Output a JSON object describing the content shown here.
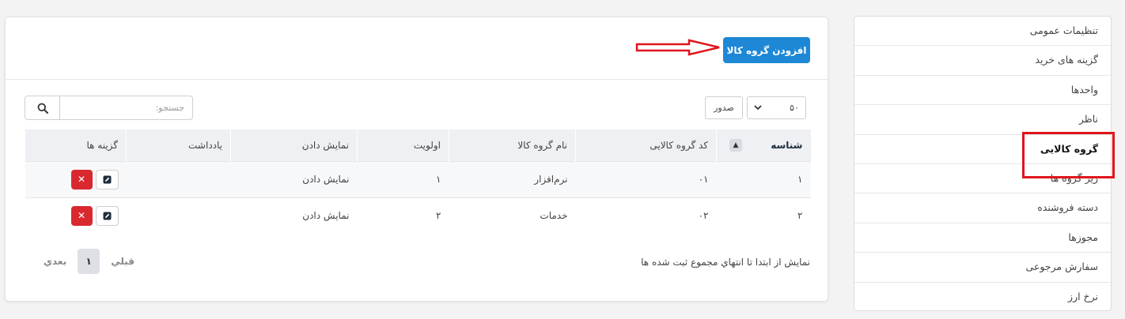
{
  "sidebar": {
    "items": [
      {
        "label": "تنظیمات عمومی"
      },
      {
        "label": "گزینه های خرید"
      },
      {
        "label": "واحدها"
      },
      {
        "label": "ناظر"
      },
      {
        "label": "گروه کالایی"
      },
      {
        "label": "زیر گروه ها"
      },
      {
        "label": "دسته فروشنده"
      },
      {
        "label": "مجوزها"
      },
      {
        "label": "سفارش مرجوعی"
      },
      {
        "label": "نرخ ارز"
      }
    ],
    "active_index": 4
  },
  "header": {
    "add_button_label": "افزودن گروه کالا"
  },
  "search": {
    "placeholder": "جستجو:",
    "value": ""
  },
  "page_size": {
    "value": "۵۰",
    "rows_label": "صدور"
  },
  "table": {
    "columns": [
      "شناسه",
      "کد گروه کالایی",
      "نام گروه کالا",
      "اولویت",
      "نمایش دادن",
      "یادداشت",
      "گزینه ها"
    ],
    "rows": [
      {
        "id": "۱",
        "code": "۰۱",
        "name": "نرم‌افزار",
        "priority": "۱",
        "display": "نمایش دادن",
        "note": ""
      },
      {
        "id": "۲",
        "code": "۰۲",
        "name": "خدمات",
        "priority": "۲",
        "display": "نمایش دادن",
        "note": ""
      }
    ]
  },
  "footer": {
    "info": "نمایش از ابتدا تا انتهاي مجموع ثبت شده ها",
    "prev_label": "قبلي",
    "current_page": "۱",
    "next_label": "بعدي"
  },
  "colors": {
    "primary": "#1e88d6",
    "danger": "#d9292f",
    "highlight": "#e0141c"
  }
}
